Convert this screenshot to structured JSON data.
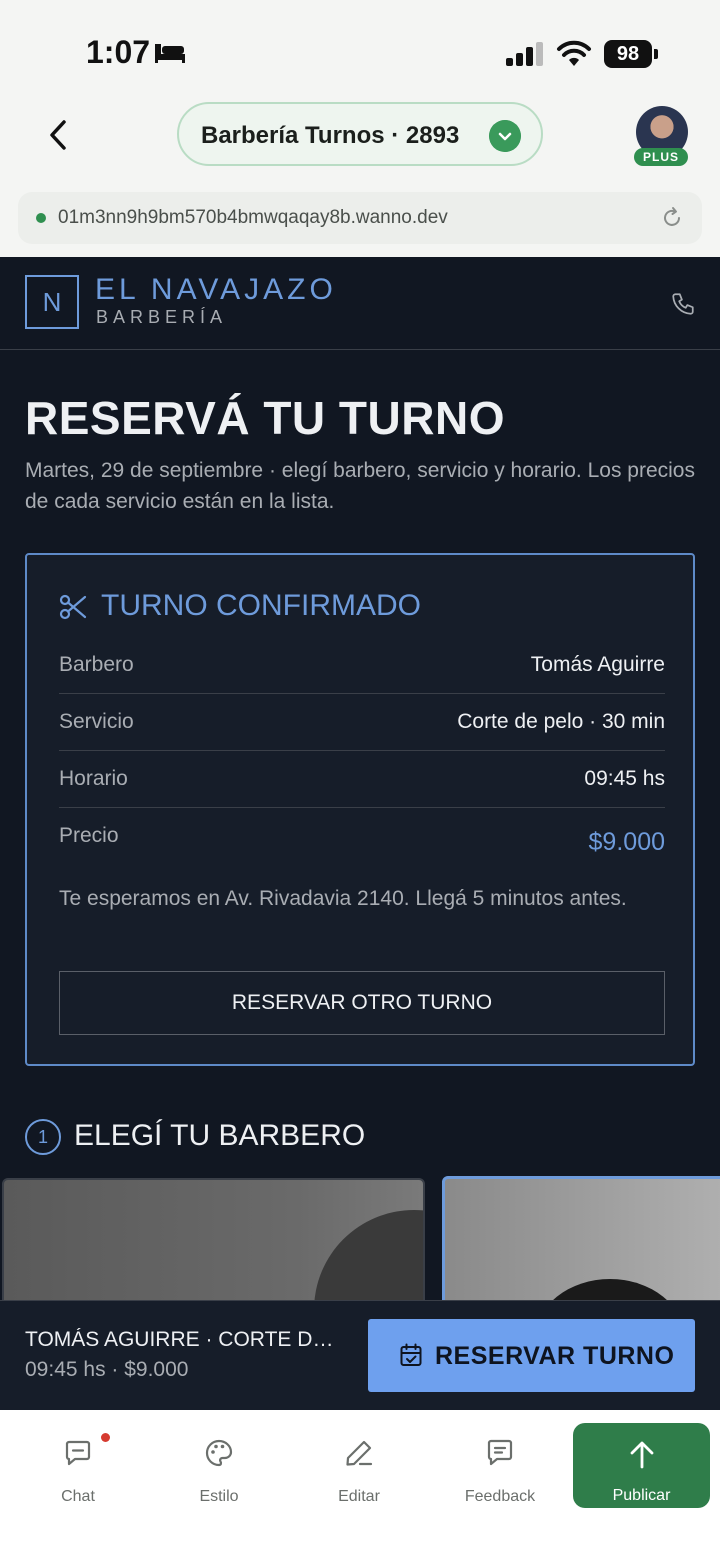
{
  "status_bar": {
    "time": "1:07",
    "battery": "98"
  },
  "nav": {
    "title": "Barbería Turnos · 2893",
    "badge": "PLUS"
  },
  "url_bar": {
    "url": "01m3nn9h9bm570b4bmwqaqay8b.wanno.dev"
  },
  "site": {
    "logo_letter": "N",
    "brand": "EL NAVAJAZO",
    "brand_sub": "BARBERÍA",
    "heading": "RESERVÁ TU TURNO",
    "lead": "Martes, 29 de septiembre · elegí barbero, servicio y horario. Los precios de cada servicio están en la lista.",
    "confirmation": {
      "title": "TURNO CONFIRMADO",
      "rows": [
        {
          "label": "Barbero",
          "value": "Tomás Aguirre"
        },
        {
          "label": "Servicio",
          "value": "Corte de pelo · 30 min"
        },
        {
          "label": "Horario",
          "value": "09:45 hs"
        },
        {
          "label": "Precio",
          "value": "$9.000"
        }
      ],
      "note": "Te esperamos en Av. Rivadavia 2140. Llegá 5 minutos antes.",
      "again_button": "RESERVAR OTRO TURNO"
    },
    "step": {
      "number": "1",
      "title": "ELEGÍ TU BARBERO"
    },
    "booking_bar": {
      "summary": "TOMÁS AGUIRRE · CORTE DE ...",
      "detail": "09:45 hs · $9.000",
      "button": "RESERVAR TURNO"
    },
    "colors": {
      "background": "#111722",
      "accent": "#6e9bdb",
      "button": "#6ea0ee"
    }
  },
  "tabs": [
    {
      "label": "Chat",
      "icon": "chat-icon"
    },
    {
      "label": "Estilo",
      "icon": "palette-icon"
    },
    {
      "label": "Editar",
      "icon": "pencil-icon"
    },
    {
      "label": "Feedback",
      "icon": "feedback-icon"
    },
    {
      "label": "Publicar",
      "icon": "arrow-up-icon"
    }
  ]
}
